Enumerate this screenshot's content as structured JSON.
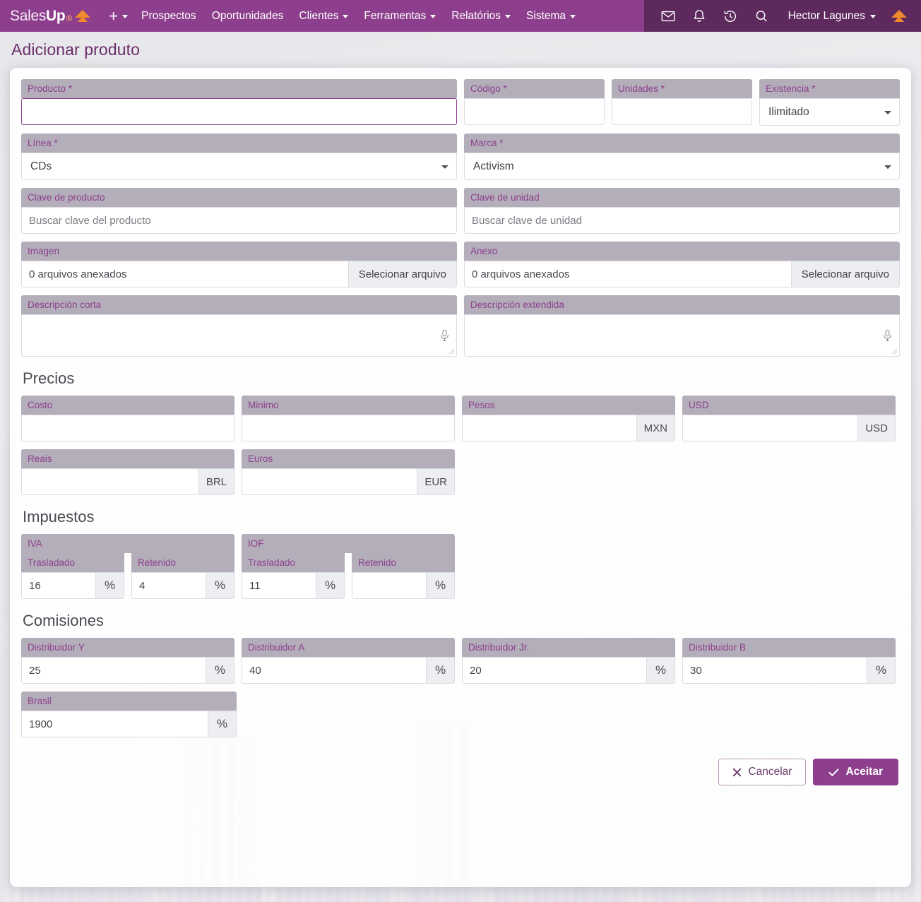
{
  "navbar": {
    "brand": {
      "part1": "Sales",
      "part2": "Up",
      "part3": "®",
      "logo_icon": "triangle-logo"
    },
    "add_label": "+",
    "items": [
      {
        "label": "Prospectos",
        "caret": false
      },
      {
        "label": "Oportunidades",
        "caret": false
      },
      {
        "label": "Clientes",
        "caret": true
      },
      {
        "label": "Ferramentas",
        "caret": true
      },
      {
        "label": "Relatórios",
        "caret": true
      },
      {
        "label": "Sistema",
        "caret": true
      }
    ],
    "icons": [
      "mail-icon",
      "bell-icon",
      "history-icon",
      "search-icon"
    ],
    "user": "Hector Lagunes",
    "accent": "#8d3f8d",
    "accent_dark": "#5e2a5e",
    "logo_orange": "#f08a2a"
  },
  "page": {
    "title": "Adicionar produto"
  },
  "form": {
    "producto": {
      "label": "Producto *",
      "value": "",
      "focused": true
    },
    "codigo": {
      "label": "Código *",
      "value": ""
    },
    "unidades": {
      "label": "Unidades *",
      "value": ""
    },
    "existencia": {
      "label": "Existencia *",
      "value": "Ilimitado",
      "options": [
        "Ilimitado"
      ]
    },
    "linea": {
      "label": "Línea *",
      "value": "CDs",
      "options": [
        "CDs"
      ]
    },
    "marca": {
      "label": "Marca *",
      "value": "Activism",
      "options": [
        "Activism"
      ]
    },
    "clave_producto": {
      "label": "Clave de producto",
      "value": "",
      "placeholder": "Buscar clave del producto"
    },
    "clave_unidad": {
      "label": "Clave de unidad",
      "value": "",
      "placeholder": "Buscar clave de unidad"
    },
    "imagen": {
      "label": "Imagen",
      "status": "0 arquivos anexados",
      "button": "Selecionar arquivo"
    },
    "anexo": {
      "label": "Anexo",
      "status": "0 arquivos anexados",
      "button": "Selecionar arquivo"
    },
    "descripcion_corta": {
      "label": "Descripción corta",
      "value": "",
      "mic_icon": "microphone-icon"
    },
    "descripcion_extendida": {
      "label": "Descripción extendida",
      "value": "",
      "mic_icon": "microphone-icon"
    }
  },
  "precios": {
    "title": "Precios",
    "fields": [
      {
        "label": "Costo",
        "value": "",
        "suffix": ""
      },
      {
        "label": "Minimo",
        "value": "",
        "suffix": ""
      },
      {
        "label": "Pesos",
        "value": "",
        "suffix": "MXN"
      },
      {
        "label": "USD",
        "value": "",
        "suffix": "USD"
      },
      {
        "label": "Reais",
        "value": "",
        "suffix": "BRL"
      },
      {
        "label": "Euros",
        "value": "",
        "suffix": "EUR"
      }
    ]
  },
  "impuestos": {
    "title": "Impuestos",
    "groups": [
      {
        "label": "IVA",
        "subs": [
          {
            "label": "Trasladado",
            "value": "16",
            "suffix": "%"
          },
          {
            "label": "Retenido",
            "value": "4",
            "suffix": "%"
          }
        ]
      },
      {
        "label": "IOF",
        "subs": [
          {
            "label": "Trasladado",
            "value": "11",
            "suffix": "%"
          },
          {
            "label": "Retenido",
            "value": "",
            "suffix": "%"
          }
        ]
      }
    ]
  },
  "comisiones": {
    "title": "Comisiones",
    "fields": [
      {
        "label": "Distribuidor Y",
        "value": "25",
        "suffix": "%"
      },
      {
        "label": "Distribuidor A",
        "value": "40",
        "suffix": "%"
      },
      {
        "label": "Distribuidor Jr.",
        "value": "20",
        "suffix": "%"
      },
      {
        "label": "Distribuidor B",
        "value": "30",
        "suffix": "%"
      },
      {
        "label": "Brasil",
        "value": "1900",
        "suffix": "%"
      }
    ]
  },
  "footer": {
    "cancel": {
      "label": "Cancelar",
      "icon": "close-icon"
    },
    "accept": {
      "label": "Aceitar",
      "icon": "check-icon"
    }
  }
}
